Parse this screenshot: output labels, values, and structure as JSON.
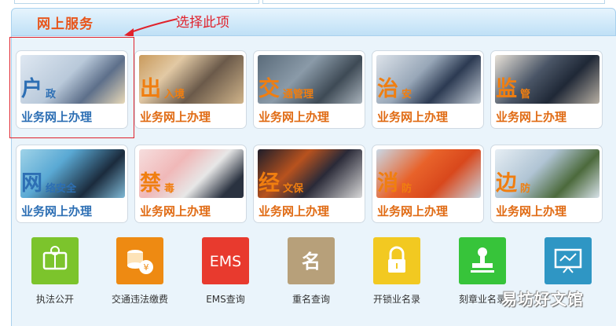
{
  "header": {
    "title": "网上服务"
  },
  "annotation": {
    "text": "选择此项",
    "color": "#e0222c"
  },
  "tiles_row1": [
    {
      "big": "户",
      "small": "政",
      "sub": "业务网上办理",
      "style": "blue"
    },
    {
      "big": "出",
      "small": "入境",
      "sub": "业务网上办理",
      "style": "orange"
    },
    {
      "big": "交",
      "small": "通管理",
      "sub": "业务网上办理",
      "style": "orange"
    },
    {
      "big": "治",
      "small": "安",
      "sub": "业务网上办理",
      "style": "orange"
    },
    {
      "big": "监",
      "small": "管",
      "sub": "业务网上办理",
      "style": "orange"
    }
  ],
  "tiles_row2": [
    {
      "big": "网",
      "small": "络安全",
      "sub": "业务网上办理",
      "style": "blue"
    },
    {
      "big": "禁",
      "small": "毒",
      "sub": "业务网上办理",
      "style": "orange"
    },
    {
      "big": "经",
      "small": "文保",
      "sub": "业务网上办理",
      "style": "orange"
    },
    {
      "big": "消",
      "small": "防",
      "sub": "业务网上办理",
      "style": "orange"
    },
    {
      "big": "边",
      "small": "防",
      "sub": "业务网上办理",
      "style": "orange"
    }
  ],
  "services": [
    {
      "label": "执法公开",
      "icon": "law-book-icon",
      "color": "#7cc42c",
      "glyph": ""
    },
    {
      "label": "交通违法缴费",
      "icon": "coin-icon",
      "color": "#ee8a12",
      "glyph": "¥"
    },
    {
      "label": "EMS查询",
      "icon": "ems-icon",
      "color": "#e83a2e",
      "glyph": "EMS"
    },
    {
      "label": "重名查询",
      "icon": "name-icon",
      "color": "#b7a07a",
      "glyph": "名"
    },
    {
      "label": "开锁业名录",
      "icon": "lock-icon",
      "color": "#f2c921",
      "glyph": ""
    },
    {
      "label": "刻章业名录",
      "icon": "stamp-icon",
      "color": "#37c43a",
      "glyph": ""
    },
    {
      "label": "",
      "icon": "screen-icon",
      "color": "#2f96c4",
      "glyph": ""
    }
  ],
  "watermark": "易坊好文馆"
}
